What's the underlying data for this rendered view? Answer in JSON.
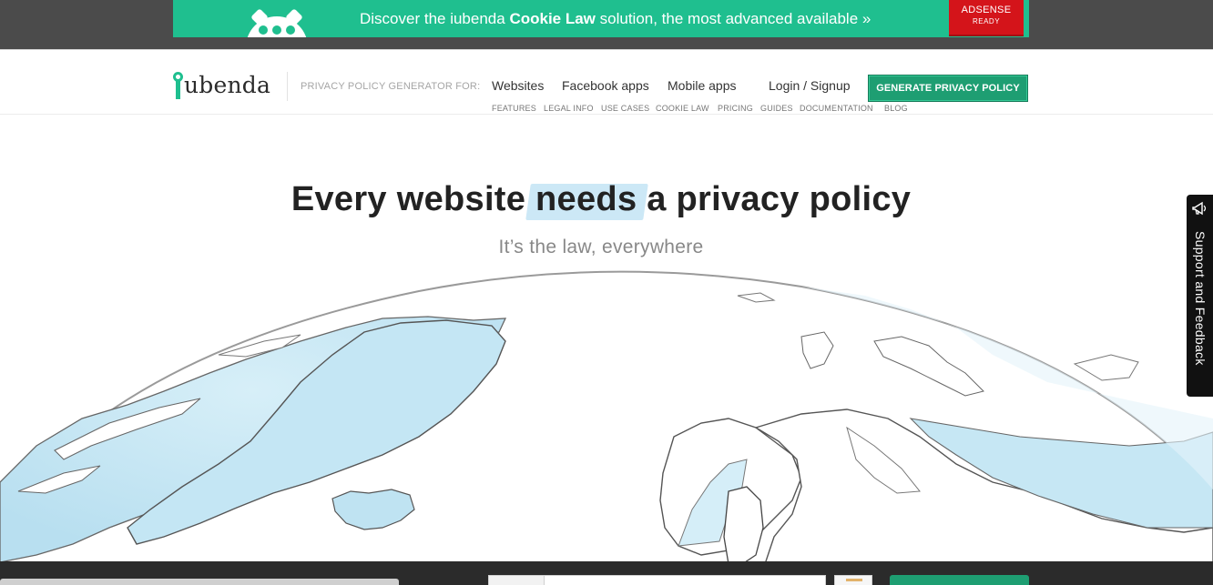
{
  "promo": {
    "text_before": "Discover the iubenda ",
    "text_bold": "Cookie Law",
    "text_after": " solution, the most advanced available »",
    "badge_line1": "ADSENSE",
    "badge_line2": "READY"
  },
  "header": {
    "logo_text": "ubenda",
    "generator_label": "PRIVACY POLICY GENERATOR FOR:",
    "nav": [
      "Websites",
      "Facebook apps",
      "Mobile apps"
    ],
    "login": "Login / Signup",
    "cta": "GENERATE PRIVACY POLICY",
    "subnav": [
      "FEATURES",
      "LEGAL INFO",
      "USE CASES",
      "COOKIE LAW",
      "PRICING",
      "GUIDES",
      "DOCUMENTATION",
      "BLOG"
    ]
  },
  "hero": {
    "title_before": "Every website ",
    "title_highlight": "needs",
    "title_after": " a privacy policy",
    "subtitle": "It’s the law, everywhere"
  },
  "support": {
    "label": "Support and Feedback",
    "icon": "megaphone-icon"
  },
  "colors": {
    "brand_green": "#1fbf8f",
    "cta_green": "#1e9e72",
    "adsense_red": "#d4141a",
    "highlight_blue": "#cce8f6",
    "ocean_blue": "#bfe3f2"
  }
}
